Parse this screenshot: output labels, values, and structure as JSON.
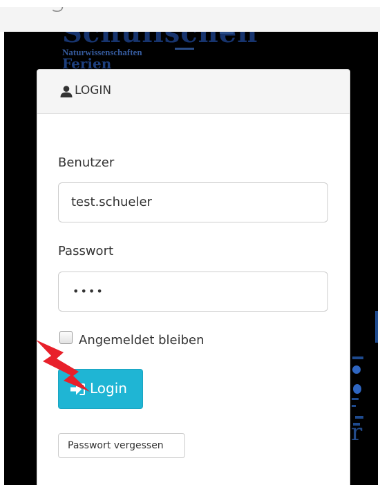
{
  "page": {
    "title": "Login"
  },
  "background": {
    "headline_word": "Schulischen",
    "subline_word": "Naturwissenschaften",
    "partial_word": "Ferien"
  },
  "login_panel": {
    "title": "LOGIN",
    "username": {
      "label": "Benutzer",
      "value": "test.schueler"
    },
    "password": {
      "label": "Passwort",
      "masked_value": "••••"
    },
    "remember_me": {
      "label": "Angemeldet bleiben",
      "checked": false
    },
    "submit_label": "Login",
    "forgot_password_label": "Passwort vergessen"
  },
  "colors": {
    "primary_button": "#1fb5d4",
    "annotation_bolt": "#e8202a",
    "panel_heading": "#f5f5f5"
  },
  "icons": {
    "panel_heading": "user-icon",
    "submit_button": "sign-in-icon",
    "annotation": "lightning-bolt-icon"
  }
}
